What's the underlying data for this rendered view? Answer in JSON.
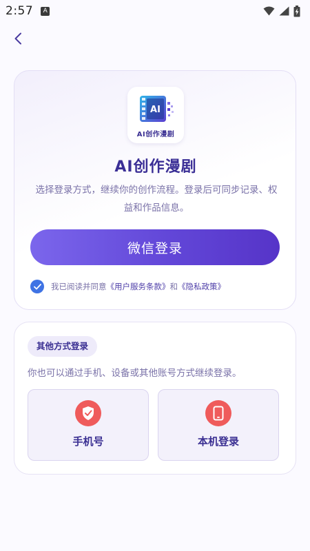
{
  "status_bar": {
    "time": "2:57",
    "notification_glyph": "A",
    "icons": [
      "wifi-icon",
      "signal-icon",
      "battery-charging-icon"
    ]
  },
  "nav": {
    "back_icon": "chevron-left-icon"
  },
  "main_card": {
    "logo_caption": "AI创作漫剧",
    "title": "AI创作漫剧",
    "description": "选择登录方式，继续你的创作流程。登录后可同步记录、权益和作品信息。",
    "wechat_button": "微信登录",
    "agreement": {
      "prefix": "我已阅读并同意",
      "terms": "《用户服务条款》",
      "and": "和",
      "privacy": "《隐私政策》",
      "checked": true
    }
  },
  "other_login": {
    "badge": "其他方式登录",
    "description": "你也可以通过手机、设备或其他账号方式继续登录。",
    "options": [
      {
        "label": "手机号",
        "icon": "shield-icon"
      },
      {
        "label": "本机登录",
        "icon": "phone-icon"
      }
    ]
  },
  "colors": {
    "accent": "#6247d8",
    "title": "#3b2f96",
    "muted": "#7a72a8",
    "icon_red": "#ef5b5b",
    "check_blue": "#3f73e4"
  }
}
